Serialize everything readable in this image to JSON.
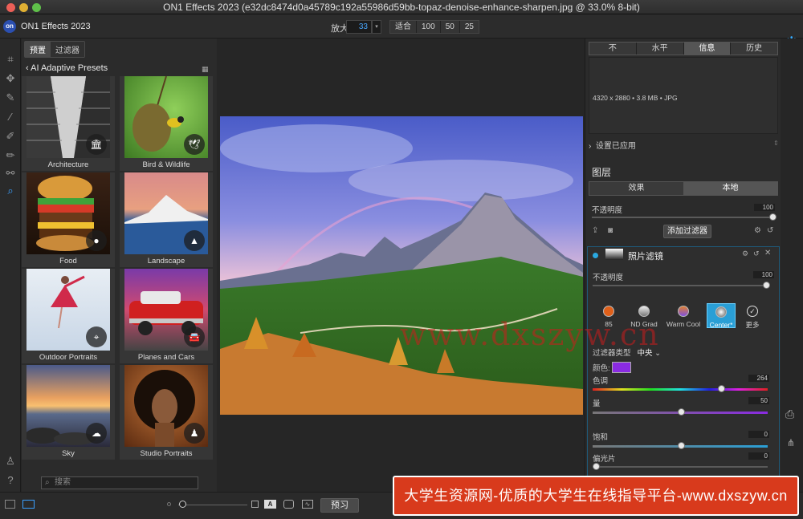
{
  "window": {
    "title": "ON1 Effects 2023 (e32dc8474d0a45789c192a55986d59bb-topaz-denoise-enhance-sharpen.jpg @ 33.0% 8-bit)"
  },
  "toolbar": {
    "app_name": "ON1 Effects 2023",
    "zoom_label": "放大",
    "zoom_value": "33",
    "fit_label": "适合",
    "zoom_100": "100",
    "zoom_50": "50",
    "zoom_25": "25"
  },
  "left_panel": {
    "tab_presets": "预置",
    "tab_filters": "过滤器",
    "breadcrumb": "AI Adaptive Presets",
    "presets": [
      {
        "label": "Architecture",
        "icon": "bank-icon"
      },
      {
        "label": "Bird & Wildlife",
        "icon": "bird-icon"
      },
      {
        "label": "Food",
        "icon": "apple-icon"
      },
      {
        "label": "Landscape",
        "icon": "mountain-icon"
      },
      {
        "label": "Outdoor Portraits",
        "icon": "location-pin-icon"
      },
      {
        "label": "Planes and Cars",
        "icon": "car-icon"
      },
      {
        "label": "Sky",
        "icon": "cloud-icon"
      },
      {
        "label": "Studio Portraits",
        "icon": "person-icon"
      }
    ],
    "search_placeholder": "搜索"
  },
  "right_panel": {
    "tabs": [
      "不",
      "水平",
      "信息",
      "历史"
    ],
    "selected_tab": "信息",
    "image_info": "4320 x 2880 • 3.8 MB • JPG",
    "settings_applied": "设置已应用",
    "layers_title": "图层",
    "effects_tab": "效果",
    "local_tab": "本地",
    "opacity_label": "不透明度",
    "opacity_value": "100",
    "opacity_level": 100,
    "add_filter": "添加过滤器",
    "filter": {
      "name": "照片滤镜",
      "opacity_label": "不透明度",
      "opacity_value": "100",
      "opacity_level": 100,
      "presets": [
        "85",
        "ND Grad",
        "Warm Cool",
        "Center*",
        "更多"
      ],
      "active_preset": "Center*",
      "filter_type_label": "过滤器类型",
      "filter_type_value": "中央",
      "color_label": "颜色:",
      "color_value": "#8a2be2",
      "hue_label": "色调",
      "hue_value": "264",
      "amount_label": "量",
      "amount_value": "50",
      "saturation_label": "饱和",
      "saturation_value": "0",
      "polarizer_label": "偏光片",
      "polarizer_value": "0"
    }
  },
  "bottom": {
    "preview_label": "预习"
  },
  "overlay": {
    "watermark": "www.dxszyw.cn",
    "banner": "大学生资源网-优质的大学生在线指导平台-www.dxszyw.cn"
  }
}
